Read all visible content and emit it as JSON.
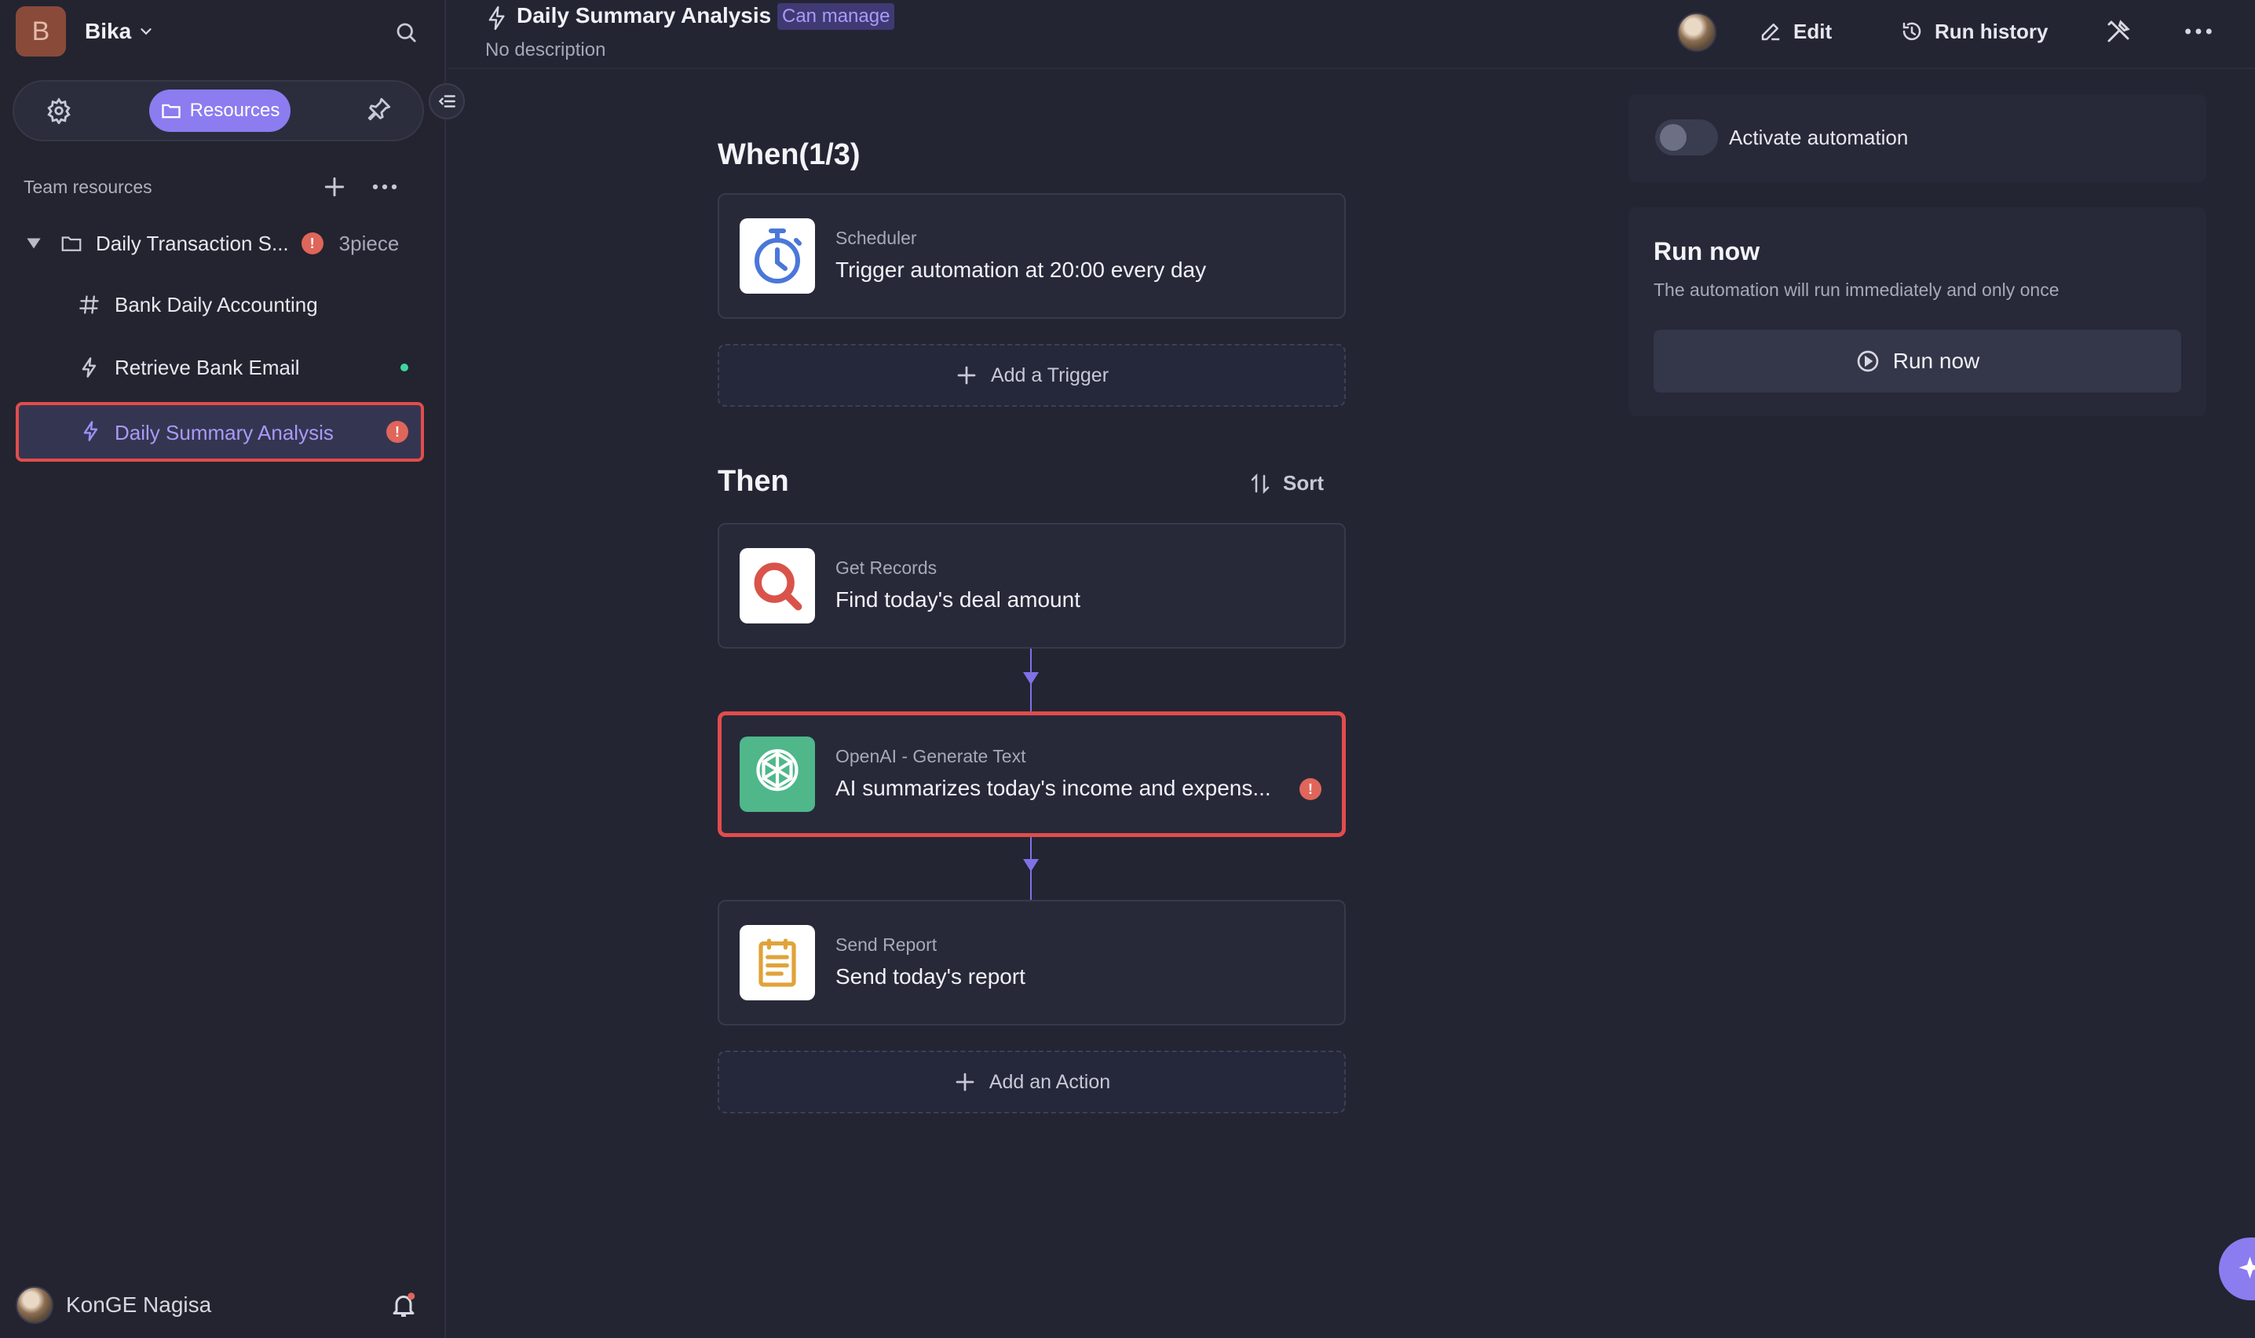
{
  "workspace": {
    "logo_letter": "B",
    "name": "Bika"
  },
  "nav_tabs": {
    "resources_label": "Resources"
  },
  "sidebar": {
    "section_label": "Team resources",
    "folder": {
      "label": "Daily Transaction S...",
      "count": "3piece"
    },
    "items": [
      {
        "label": "Bank Daily Accounting",
        "icon": "hash-icon"
      },
      {
        "label": "Retrieve Bank Email",
        "icon": "bolt-icon"
      },
      {
        "label": "Daily Summary Analysis",
        "icon": "bolt-icon"
      }
    ]
  },
  "user": {
    "name": "KonGE Nagisa"
  },
  "header": {
    "title": "Daily Summary Analysis",
    "permission_badge": "Can manage",
    "description": "No description",
    "edit_label": "Edit",
    "run_history_label": "Run history"
  },
  "flow": {
    "when_title": "When(1/3)",
    "trigger": {
      "type": "Scheduler",
      "description": "Trigger automation at 20:00 every day"
    },
    "add_trigger_label": "Add a Trigger",
    "then_title": "Then",
    "sort_label": "Sort",
    "actions": [
      {
        "type": "Get Records",
        "description": "Find today's deal amount"
      },
      {
        "type": "OpenAI - Generate Text",
        "description": "AI summarizes today's income and expens..."
      },
      {
        "type": "Send Report",
        "description": "Send today's report"
      }
    ],
    "add_action_label": "Add an Action"
  },
  "panel": {
    "activate_label": "Activate automation",
    "run_now_title": "Run now",
    "run_now_subtitle": "The automation will run immediately and only once",
    "run_now_button": "Run now"
  },
  "colors": {
    "accent": "#8b7cf0",
    "error": "#e0655a",
    "highlight_border": "#e24c4c",
    "openai_green": "#4fb78a",
    "online_green": "#3dd6a0"
  }
}
